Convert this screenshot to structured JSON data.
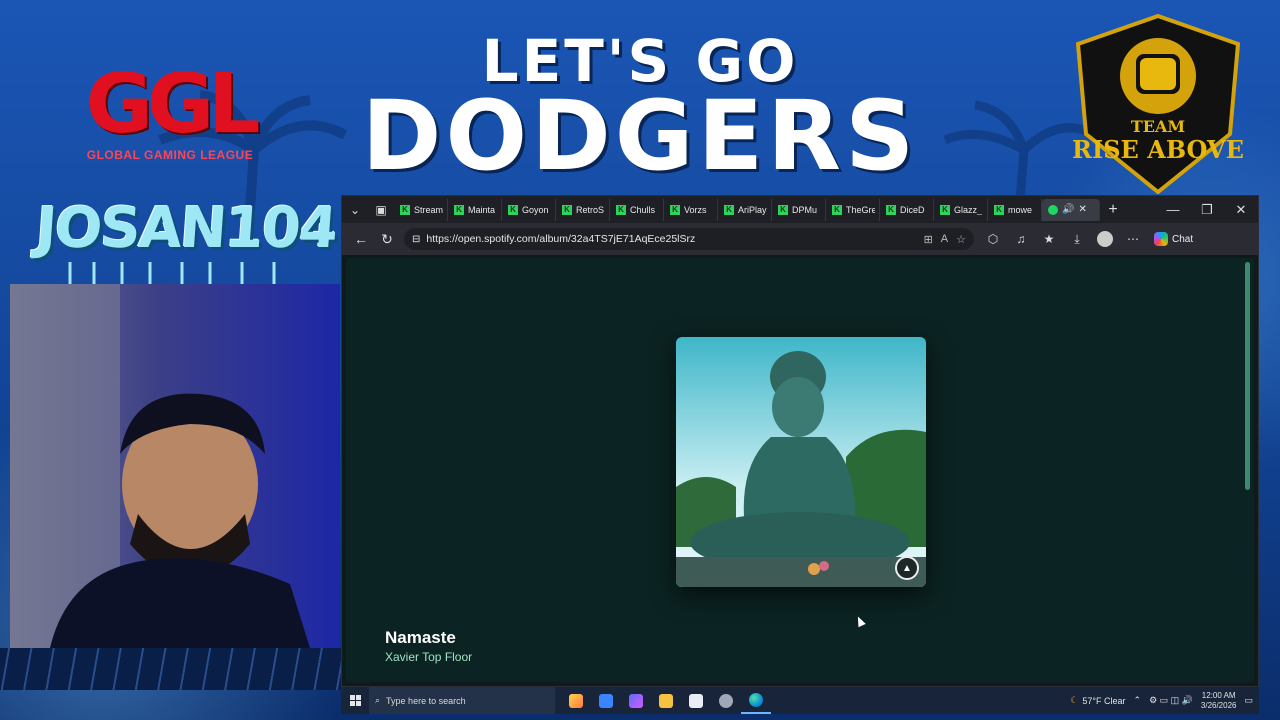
{
  "overlay": {
    "headline_line1": "LET'S GO",
    "headline_line2": "DODGERS",
    "left_logo_letters": "GGL",
    "left_logo_subtitle": "GLOBAL GAMING LEAGUE",
    "gamertag": "JOSAN104",
    "team_badge_line1": "TEAM",
    "team_badge_line2": "RISE ABOVE"
  },
  "browser": {
    "tabs": [
      {
        "label": "Stream",
        "icon": "kick-icon"
      },
      {
        "label": "Mainta",
        "icon": "kick-icon"
      },
      {
        "label": "Goyon",
        "icon": "kick-icon"
      },
      {
        "label": "RetroS",
        "icon": "kick-icon"
      },
      {
        "label": "Chulls",
        "icon": "kick-icon"
      },
      {
        "label": "Vorzs",
        "icon": "kick-icon"
      },
      {
        "label": "AriPlay",
        "icon": "kick-icon"
      },
      {
        "label": "DPMu",
        "icon": "kick-icon"
      },
      {
        "label": "TheGre",
        "icon": "kick-icon"
      },
      {
        "label": "DiceD",
        "icon": "kick-icon"
      },
      {
        "label": "Glazz_",
        "icon": "kick-icon"
      },
      {
        "label": "mowe",
        "icon": "kick-icon"
      }
    ],
    "active_tab_icon": "spotify-icon",
    "url": "https://open.spotify.com/album/32a4TS7jE71AqEce25lSrz",
    "chat_label": "Chat"
  },
  "page": {
    "track_title": "Namaste",
    "track_artist": "Xavier Top Floor"
  },
  "taskbar": {
    "search_placeholder": "Type here to search",
    "weather": "57°F  Clear",
    "time": "12:00 AM",
    "date": "3/26/2026"
  },
  "colors": {
    "spotify_bg": "#0b2322",
    "artist_link": "#9ee3c2",
    "overlay_blue": "#124597",
    "ggl_red": "#e01020"
  }
}
